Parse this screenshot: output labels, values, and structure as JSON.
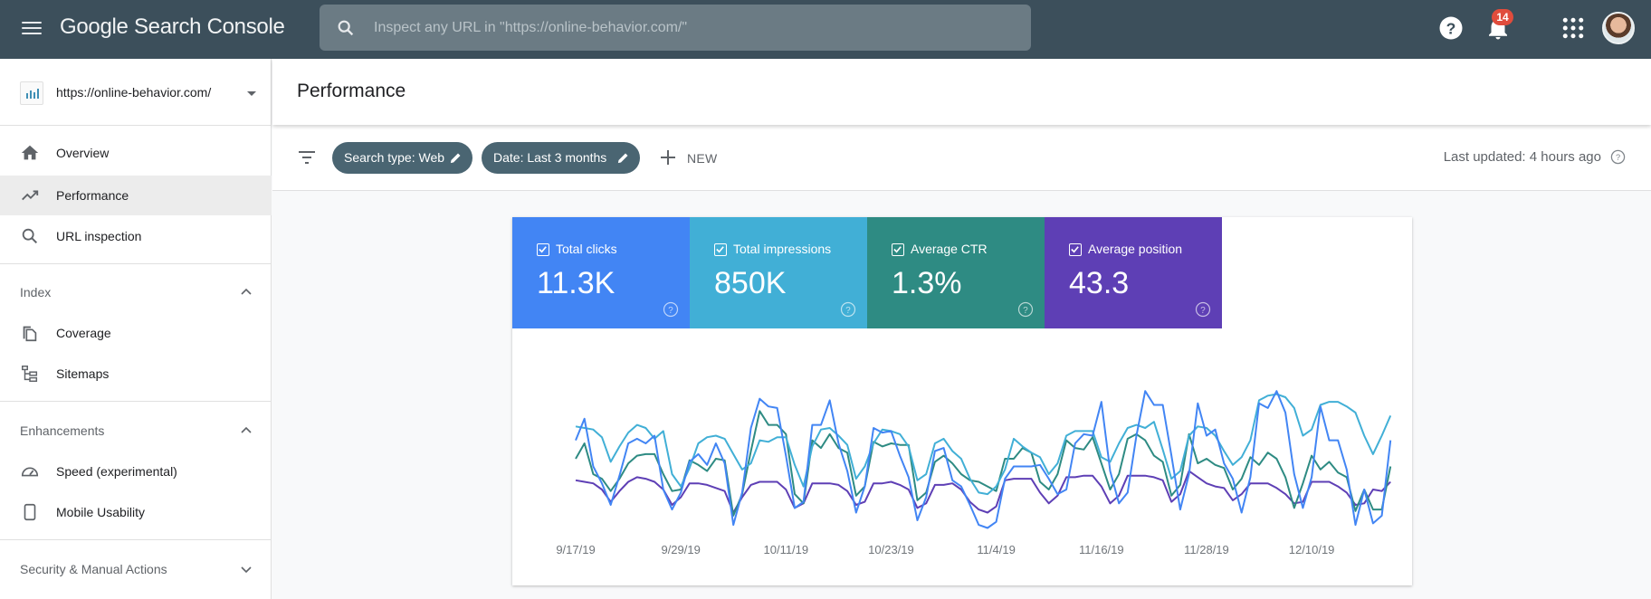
{
  "topbar": {
    "app_name_google": "Google",
    "app_name_rest": "Search Console",
    "search_placeholder": "Inspect any URL in \"https://online-behavior.com/\"",
    "notification_count": "14",
    "icons": [
      "menu-icon",
      "search-icon",
      "help-icon",
      "bell-icon",
      "apps-icon",
      "avatar"
    ]
  },
  "sidebar": {
    "property": "https://online-behavior.com/",
    "items": [
      {
        "label": "Overview",
        "icon": "home-icon"
      },
      {
        "label": "Performance",
        "icon": "trending-up-icon",
        "active": true
      },
      {
        "label": "URL inspection",
        "icon": "search-icon"
      }
    ],
    "sections": [
      {
        "label": "Index",
        "expanded": true,
        "items": [
          {
            "label": "Coverage",
            "icon": "coverage-icon"
          },
          {
            "label": "Sitemaps",
            "icon": "sitemap-icon"
          }
        ]
      },
      {
        "label": "Enhancements",
        "expanded": true,
        "items": [
          {
            "label": "Speed (experimental)",
            "icon": "speedometer-icon"
          },
          {
            "label": "Mobile Usability",
            "icon": "phone-icon"
          }
        ]
      },
      {
        "label": "Security & Manual Actions",
        "expanded": false,
        "items": []
      }
    ]
  },
  "page": {
    "title": "Performance",
    "filters": [
      {
        "label": "Search type: Web"
      },
      {
        "label": "Date: Last 3 months"
      }
    ],
    "new_label": "NEW",
    "last_updated": "Last updated: 4 hours ago"
  },
  "metrics": [
    {
      "label": "Total clicks",
      "value": "11.3K",
      "color": "#4285f4",
      "checked": true
    },
    {
      "label": "Total impressions",
      "value": "850K",
      "color": "#41afd6",
      "checked": true
    },
    {
      "label": "Average CTR",
      "value": "1.3%",
      "color": "#2e8b83",
      "checked": true
    },
    {
      "label": "Average position",
      "value": "43.3",
      "color": "#5e3fb5",
      "checked": true
    }
  ],
  "chart_data": {
    "type": "line",
    "title": "",
    "xlabel": "",
    "ylabel": "",
    "note": "Each series is independently normalized (no y-axis shown); values are relative 0-100",
    "ylim": [
      0,
      100
    ],
    "x_start": "9/17/19",
    "tick_labels": [
      "9/17/19",
      "9/29/19",
      "10/11/19",
      "10/23/19",
      "11/4/19",
      "11/16/19",
      "11/28/19",
      "12/10/19"
    ],
    "tick_every_days": 12,
    "legend": "none",
    "grid": false,
    "series": [
      {
        "name": "Total clicks",
        "color": "#4285f4",
        "values": [
          52,
          66,
          35,
          24,
          10,
          29,
          50,
          53,
          50,
          55,
          20,
          7,
          18,
          38,
          43,
          36,
          50,
          37,
          -3,
          18,
          60,
          79,
          74,
          73,
          42,
          8,
          12,
          62,
          62,
          78,
          50,
          32,
          5,
          22,
          60,
          57,
          58,
          42,
          28,
          0,
          15,
          45,
          47,
          26,
          22,
          10,
          -3,
          -5,
          -1,
          27,
          35,
          35,
          35,
          36,
          27,
          17,
          20,
          50,
          56,
          55,
          77,
          32,
          11,
          18,
          55,
          84,
          75,
          75,
          42,
          7,
          30,
          76,
          55,
          59,
          37,
          27,
          5,
          28,
          76,
          73,
          84,
          70,
          30,
          8,
          28,
          74,
          52,
          52,
          33,
          -3,
          20,
          -2,
          3,
          52
        ]
      },
      {
        "name": "Total impressions",
        "color": "#41afd6",
        "values": [
          61,
          60,
          59,
          54,
          38,
          48,
          57,
          62,
          60,
          53,
          58,
          30,
          22,
          34,
          50,
          54,
          55,
          53,
          43,
          33,
          37,
          52,
          51,
          54,
          54,
          36,
          22,
          48,
          59,
          60,
          55,
          49,
          27,
          35,
          50,
          59,
          58,
          56,
          48,
          26,
          30,
          50,
          53,
          45,
          40,
          27,
          18,
          17,
          22,
          33,
          53,
          48,
          44,
          41,
          30,
          37,
          55,
          58,
          58,
          58,
          41,
          38,
          50,
          60,
          62,
          60,
          64,
          46,
          27,
          32,
          55,
          61,
          60,
          55,
          45,
          36,
          41,
          52,
          78,
          81,
          82,
          80,
          73,
          55,
          59,
          75,
          77,
          77,
          74,
          70,
          55,
          43,
          55,
          68
        ]
      },
      {
        "name": "Average CTR",
        "color": "#2e8b83",
        "values": [
          40,
          50,
          30,
          27,
          19,
          27,
          37,
          42,
          43,
          43,
          30,
          19,
          20,
          39,
          36,
          32,
          40,
          39,
          3,
          17,
          45,
          71,
          62,
          62,
          56,
          17,
          11,
          52,
          47,
          56,
          47,
          44,
          16,
          22,
          51,
          48,
          50,
          49,
          49,
          13,
          18,
          38,
          42,
          37,
          30,
          26,
          25,
          22,
          19,
          40,
          40,
          47,
          44,
          25,
          20,
          30,
          52,
          47,
          46,
          54,
          37,
          20,
          30,
          53,
          56,
          52,
          42,
          38,
          16,
          23,
          56,
          37,
          40,
          36,
          34,
          20,
          27,
          41,
          36,
          44,
          40,
          28,
          8,
          24,
          42,
          33,
          38,
          31,
          28,
          6,
          20,
          7,
          7,
          35
        ]
      },
      {
        "name": "Average position",
        "color": "#5e3fb5",
        "values": [
          26,
          25,
          24,
          20,
          12,
          19,
          25,
          28,
          27,
          25,
          20,
          10,
          15,
          24,
          24,
          23,
          21,
          19,
          5,
          15,
          23,
          25,
          25,
          25,
          20,
          8,
          11,
          24,
          24,
          24,
          23,
          19,
          10,
          12,
          24,
          24,
          25,
          23,
          20,
          8,
          11,
          23,
          23,
          24,
          20,
          12,
          7,
          5,
          9,
          26,
          27,
          27,
          27,
          18,
          11,
          16,
          28,
          28,
          29,
          29,
          22,
          11,
          16,
          29,
          29,
          29,
          28,
          26,
          12,
          17,
          32,
          28,
          24,
          22,
          21,
          13,
          17,
          24,
          24,
          24,
          21,
          17,
          11,
          12,
          25,
          25,
          25,
          22,
          18,
          10,
          11,
          20,
          19,
          25
        ]
      }
    ]
  }
}
